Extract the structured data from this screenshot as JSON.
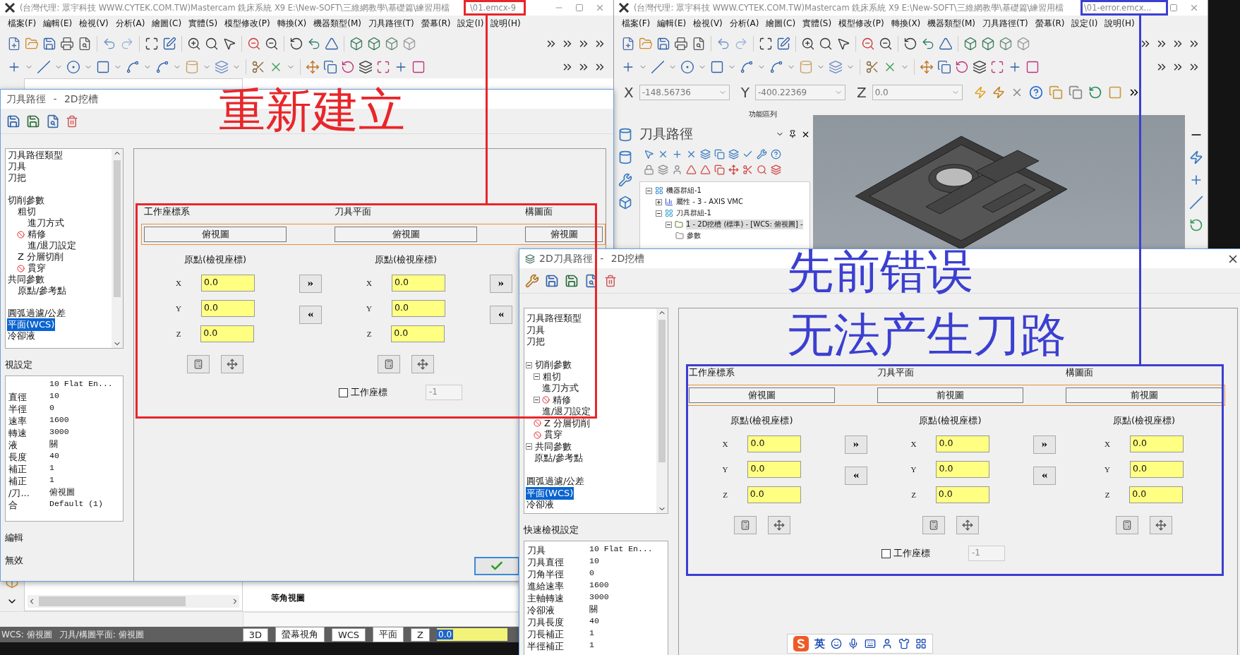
{
  "left_window": {
    "title": "(台灣代理: 眾宇科技 WWW.CYTEK.COM.TW)Mastercam 銑床系統 X9  E:\\New-SOFT\\三維網教學\\基礎篇\\練習用檔",
    "file": "\\01.emcx-9",
    "menu": [
      "檔案(F)",
      "編輯(E)",
      "檢視(V)",
      "分析(A)",
      "繪圖(C)",
      "實體(S)",
      "模型修改(P)",
      "轉換(X)",
      "機器類型(M)",
      "刀具路徑(T)",
      "螢幕(R)",
      "設定(I)",
      "說明(H)"
    ],
    "viewport_label": "等角視圖",
    "status_bar": {
      "texts": [
        "WCS: 俯視圖",
        "刀具/構圖平面: 俯視圖"
      ],
      "buttons": [
        "3D",
        "螢幕視角",
        "WCS",
        "平面",
        "Z"
      ],
      "z_value": "0.0"
    }
  },
  "right_window": {
    "title": "(台灣代理: 眾宇科技 WWW.CYTEK.COM.TW)Mastercam 銑床系統 X9  E:\\New-SOFT\\三維網教學\\基礎篇\\練習用檔",
    "file": "\\01-error.emcx...",
    "menu": [
      "檔案(F)",
      "編輯(E)",
      "檢視(V)",
      "分析(A)",
      "繪圖(C)",
      "實體(S)",
      "模型修改(P)",
      "轉換(X)",
      "機器類型(M)",
      "刀具路徑(T)",
      "螢幕(R)",
      "設定(I)",
      "說明(H)"
    ],
    "coords": [
      {
        "axis": "X",
        "value": "-148.56736"
      },
      {
        "axis": "Y",
        "value": "-400.22369"
      },
      {
        "axis": "Z",
        "value": "0.0"
      }
    ],
    "ribbon_label": "功能區列",
    "toolpath_panel": {
      "title": "刀具路徑",
      "tree": [
        {
          "label": "機器群組-1",
          "kind": "machine",
          "expanded": true,
          "selected": false,
          "children": [
            {
              "label": "屬性 - 3 - AXIS VMC",
              "kind": "properties",
              "expanded": false,
              "selected": false
            },
            {
              "label": "刀具群組-1",
              "kind": "group",
              "expanded": true,
              "selected": false,
              "children": [
                {
                  "label": "1 - 2D挖槽 (標準) - [WCS: 俯視圖] -",
                  "kind": "operation",
                  "expanded": true,
                  "selected": true,
                  "children": [
                    {
                      "label": "參數",
                      "kind": "folder",
                      "selected": false
                    }
                  ]
                }
              ]
            }
          ]
        }
      ]
    }
  },
  "dialogs": [
    {
      "title": "刀具路徑 - 2D挖槽",
      "closable": false,
      "tree": [
        {
          "label": "刀具路徑類型",
          "selected": false,
          "error": false
        },
        {
          "label": "刀具",
          "selected": false,
          "error": false
        },
        {
          "label": "刀把",
          "selected": false,
          "error": false
        },
        {
          "label": "切削參數",
          "selected": false,
          "error": false,
          "children": [
            {
              "label": "粗切",
              "selected": false,
              "error": false,
              "children": [
                {
                  "label": "進刀方式",
                  "selected": false,
                  "error": false
                }
              ]
            },
            {
              "label": "精修",
              "selected": false,
              "error": true,
              "children": [
                {
                  "label": "進/退刀設定",
                  "selected": false,
                  "error": false
                }
              ]
            },
            {
              "label": "Z 分層切削",
              "selected": false,
              "error": false
            },
            {
              "label": "貫穿",
              "selected": false,
              "error": true
            }
          ]
        },
        {
          "label": "共同參數",
          "selected": false,
          "error": false,
          "children": [
            {
              "label": "原點/參考點",
              "selected": false,
              "error": false
            }
          ]
        },
        {
          "label": "圓弧過濾/公差",
          "selected": false,
          "error": false
        },
        {
          "label": "平面(WCS)",
          "selected": true,
          "error": false
        },
        {
          "label": "冷卻液",
          "selected": false,
          "error": false
        }
      ],
      "quick_title": "視設定",
      "quick": [
        {
          "value": "10 Flat En..."
        },
        {
          "label": "直徑",
          "value": "10"
        },
        {
          "label": "半徑",
          "value": "0"
        },
        {
          "label": "速率",
          "value": "1600"
        },
        {
          "label": "轉速",
          "value": "3000"
        },
        {
          "label": "液",
          "value": "關"
        },
        {
          "label": "長度",
          "value": "40"
        },
        {
          "label": "補正",
          "value": "1"
        },
        {
          "label": "補正",
          "value": "1"
        },
        {
          "label": "/刀...",
          "value": "俯視圖"
        },
        {
          "label": "合",
          "value": "Default (1)"
        }
      ],
      "footer": [
        "編輯",
        "無效"
      ],
      "groups": [
        {
          "title": "工作座標系",
          "view": "俯視圖",
          "origin": {
            "title": "原點(檢視座標)",
            "fields": [
              {
                "label": "X",
                "value": "0.0"
              },
              {
                "label": "Y",
                "value": "0.0"
              },
              {
                "label": "Z",
                "value": "0.0"
              }
            ]
          }
        },
        {
          "title": "刀具平面",
          "view": "俯視圖",
          "origin": {
            "title": "原點(檢視座標)",
            "fields": [
              {
                "label": "X",
                "value": "0.0"
              },
              {
                "label": "Y",
                "value": "0.0"
              },
              {
                "label": "Z",
                "value": "0.0"
              }
            ]
          }
        },
        {
          "title": "構圖面",
          "view": "俯視圖"
        }
      ],
      "wcs_checkbox": {
        "label": "工作座標",
        "checked": false,
        "field": {
          "value": "-1",
          "disabled": true
        }
      },
      "buttons": [
        {
          "kind": "ok"
        }
      ]
    },
    {
      "title": "2D刀具路徑 - 2D挖槽",
      "closable": true,
      "tree": [
        {
          "label": "刀具路徑類型",
          "selected": false,
          "error": false
        },
        {
          "label": "刀具",
          "selected": false,
          "error": false
        },
        {
          "label": "刀把",
          "selected": false,
          "error": false
        },
        {
          "label": "切削參數",
          "selected": false,
          "error": false,
          "expanded": true,
          "children": [
            {
              "label": "粗切",
              "selected": false,
              "error": false,
              "expanded": true,
              "children": [
                {
                  "label": "進刀方式",
                  "selected": false,
                  "error": false
                }
              ]
            },
            {
              "label": "精修",
              "selected": false,
              "error": true,
              "expanded": true,
              "children": [
                {
                  "label": "進/退刀設定",
                  "selected": false,
                  "error": false
                }
              ]
            },
            {
              "label": "Z 分層切削",
              "selected": false,
              "error": true
            },
            {
              "label": "貫穿",
              "selected": false,
              "error": true
            }
          ]
        },
        {
          "label": "共同參數",
          "selected": false,
          "error": false,
          "expanded": true,
          "children": [
            {
              "label": "原點/參考點",
              "selected": false,
              "error": false
            }
          ]
        },
        {
          "label": "圓弧過濾/公差",
          "selected": false,
          "error": false
        },
        {
          "label": "平面(WCS)",
          "selected": true,
          "error": false
        },
        {
          "label": "冷卻液",
          "selected": false,
          "error": false
        }
      ],
      "quick_title": "快速檢視設定",
      "quick": [
        {
          "label": "刀具",
          "value": "10 Flat En..."
        },
        {
          "label": "刀具直徑",
          "value": "10"
        },
        {
          "label": "刀角半徑",
          "value": "0"
        },
        {
          "label": "進給速率",
          "value": "1600"
        },
        {
          "label": "主軸轉速",
          "value": "3000"
        },
        {
          "label": "冷卻液",
          "value": "關"
        },
        {
          "label": "刀具長度",
          "value": "40"
        },
        {
          "label": "刀長補正",
          "value": "1"
        },
        {
          "label": "半徑補正",
          "value": "1"
        }
      ],
      "groups": [
        {
          "title": "工作座標系",
          "view": "俯視圖",
          "origin": {
            "title": "原點(檢視座標)",
            "fields": [
              {
                "label": "X",
                "value": "0.0"
              },
              {
                "label": "Y",
                "value": "0.0"
              },
              {
                "label": "Z",
                "value": "0.0"
              }
            ]
          }
        },
        {
          "title": "刀具平面",
          "view": "前視圖",
          "origin": {
            "title": "原點(檢視座標)",
            "fields": [
              {
                "label": "X",
                "value": "0.0"
              },
              {
                "label": "Y",
                "value": "0.0"
              },
              {
                "label": "Z",
                "value": "0.0"
              }
            ]
          }
        },
        {
          "title": "構圖面",
          "view": "前視圖",
          "origin": {
            "title": "原點(檢視座標)",
            "fields": [
              {
                "label": "X",
                "value": "0.0"
              },
              {
                "label": "Y",
                "value": "0.0"
              },
              {
                "label": "Z",
                "value": "0.0"
              }
            ]
          }
        }
      ],
      "wcs_checkbox": {
        "label": "工作座標",
        "checked": false,
        "field": {
          "value": "-1",
          "disabled": true
        }
      }
    }
  ],
  "annotations": [
    {
      "lines": [
        "重新建立"
      ],
      "color": "#e8262a"
    },
    {
      "lines": [
        "先前错误",
        "无法产生刀路"
      ],
      "color": "#3b3fd1"
    }
  ],
  "ime_bar": {
    "label": "英"
  }
}
